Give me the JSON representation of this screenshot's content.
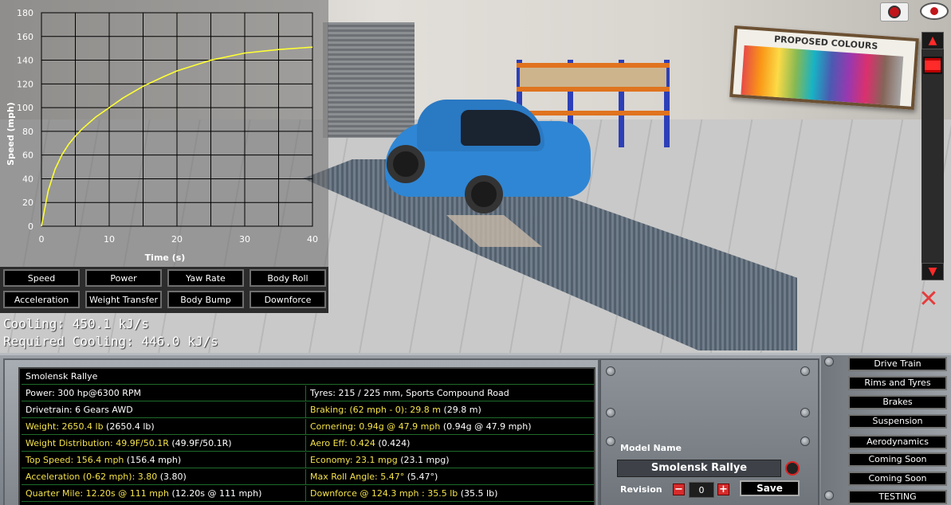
{
  "top_icons": {
    "camera": "camera-icon",
    "eye": "eye-icon"
  },
  "chart_data": {
    "type": "line",
    "xlabel": "Time (s)",
    "ylabel": "Speed (mph)",
    "xlim": [
      0,
      40
    ],
    "ylim": [
      0,
      180
    ],
    "x_ticks": [
      0,
      10,
      20,
      30,
      40
    ],
    "y_ticks": [
      0,
      20,
      40,
      60,
      80,
      100,
      120,
      140,
      160,
      180
    ],
    "grid": true,
    "series": [
      {
        "color": "#ffff33",
        "x": [
          0,
          1,
          2,
          3,
          4,
          5,
          6,
          8,
          10,
          12,
          15,
          18,
          20,
          25,
          30,
          35,
          40
        ],
        "y": [
          0,
          30,
          48,
          60,
          69,
          76,
          82,
          92,
          100,
          108,
          118,
          126,
          131,
          140,
          146,
          149,
          151
        ]
      }
    ]
  },
  "graph_buttons": [
    [
      "Speed",
      "Power",
      "Yaw Rate",
      "Body Roll"
    ],
    [
      "Acceleration",
      "Weight Transfer",
      "Body Bump",
      "Downforce"
    ]
  ],
  "cooling": {
    "cooling": "Cooling: 450.1 kJ/s",
    "required": "Required Cooling: 446.0 kJ/s"
  },
  "stats": {
    "title": "Smolensk Rallye",
    "rows": [
      {
        "left": "Power: 300 hp@6300 RPM",
        "right": "Tyres: 215 / 225 mm, Sports Compound Road",
        "left_color": "white",
        "right_color": "white"
      },
      {
        "left": "Drivetrain: 6 Gears AWD",
        "right_main": "Braking: (62 mph - 0): 29.8 m",
        "right_alt": " (29.8 m)",
        "left_color": "white",
        "right_color": "yellow"
      },
      {
        "left_main": "Weight: 2650.4 lb",
        "left_alt": " (2650.4 lb)",
        "right_main": "Cornering: 0.94g @ 47.9 mph",
        "right_alt": " (0.94g @ 47.9 mph)",
        "left_color": "yellow",
        "right_color": "yellow"
      },
      {
        "left_main": "Weight Distribution: 49.9F/50.1R",
        "left_alt": " (49.9F/50.1R)",
        "right_main": "Aero Eff: 0.424",
        "right_alt": " (0.424)",
        "left_color": "yellow",
        "right_color": "yellow"
      },
      {
        "left_main": "Top Speed: 156.4 mph",
        "left_alt": " (156.4 mph)",
        "right_main": "Economy: 23.1 mpg",
        "right_alt": " (23.1 mpg)",
        "left_color": "yellow",
        "right_color": "yellow"
      },
      {
        "left_main": "Acceleration (0-62 mph): 3.80",
        "left_alt": " (3.80)",
        "right_main": "Max Roll Angle: 5.47°",
        "right_alt": " (5.47°)",
        "left_color": "yellow",
        "right_color": "yellow"
      },
      {
        "left_main": "Quarter Mile: 12.20s @ 111 mph",
        "left_alt": " (12.20s @ 111 mph)",
        "right_main": "Downforce @ 124.3 mph : 35.5 lb",
        "right_alt": " (35.5 lb)",
        "left_color": "yellow",
        "right_color": "yellow"
      }
    ]
  },
  "model": {
    "label": "Model Name",
    "name": "Smolensk Rallye",
    "revision_label": "Revision",
    "revision_value": "0",
    "minus": "−",
    "plus": "+",
    "save": "Save"
  },
  "tabs": [
    "Drive Train",
    "Rims and Tyres",
    "Brakes",
    "Suspension",
    "Aerodynamics",
    "Coming Soon",
    "Coming Soon",
    "TESTING"
  ],
  "scene": {
    "poster_title": "PROPOSED COLOURS"
  },
  "scrollbar": {
    "up": "▲",
    "down": "▼",
    "position": 0.02
  },
  "close_glyph": "✕"
}
